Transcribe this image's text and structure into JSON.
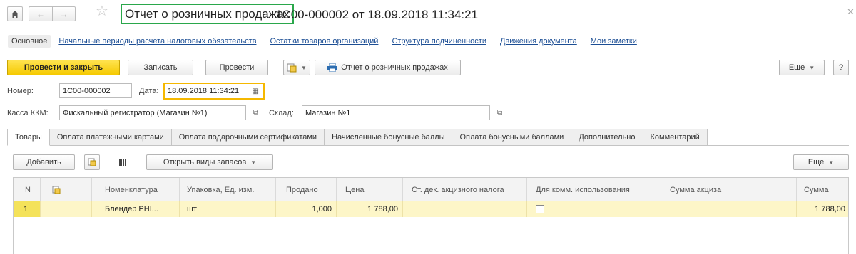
{
  "header": {
    "home_icon": "home-icon",
    "back_icon": "arrow-left-icon",
    "forward_icon": "arrow-right-icon",
    "favorite_icon": "star-icon",
    "title_main": "Отчет о розничных продажах",
    "title_rest": "1С00-000002 от 18.09.2018 11:34:21",
    "close_icon": "close-icon"
  },
  "nav_links": {
    "main": "Основное",
    "links": [
      "Начальные периоды расчета налоговых обязательств",
      "Остатки товаров организаций",
      "Структура подчиненности",
      "Движения документа",
      "Мои заметки"
    ]
  },
  "toolbar": {
    "post_close": "Провести и закрыть",
    "save": "Записать",
    "post": "Провести",
    "create_based_icon": "create-based-icon",
    "print_icon": "printer-icon",
    "print_report": "Отчет о розничных продажах",
    "more": "Еще",
    "help": "?"
  },
  "form": {
    "number_label": "Номер:",
    "number_value": "1С00-000002",
    "date_label": "Дата:",
    "date_value": "18.09.2018 11:34:21",
    "kkm_label": "Касса ККМ:",
    "kkm_value": "Фискальный регистратор (Магазин №1)",
    "warehouse_label": "Склад:",
    "warehouse_value": "Магазин №1"
  },
  "tabs": [
    "Товары",
    "Оплата платежными картами",
    "Оплата подарочными сертификатами",
    "Начисленные бонусные баллы",
    "Оплата бонусными баллами",
    "Дополнительно",
    "Комментарий"
  ],
  "table_toolbar": {
    "add": "Добавить",
    "open_stock_types": "Открыть виды запасов",
    "more": "Еще"
  },
  "table": {
    "headers": [
      "N",
      "",
      "Номенклатура",
      "Упаковка, Ед. изм.",
      "Продано",
      "Цена",
      "Ст. дек. акцизного налога",
      "Для комм. использования",
      "Сумма акциза",
      "Сумма"
    ],
    "rows": [
      {
        "n": "1",
        "item": "Блендер PHI...",
        "unit": "шт",
        "sold": "1,000",
        "price": "1 788,00",
        "excise_rate": "",
        "commercial": false,
        "excise_sum": "",
        "sum": "1 788,00"
      }
    ]
  },
  "colors": {
    "primary_button": "#f5c900",
    "title_highlight": "#2aa74b",
    "date_highlight": "#f5b800",
    "selected_row": "#fdf6c8",
    "link": "#1c4e94"
  }
}
